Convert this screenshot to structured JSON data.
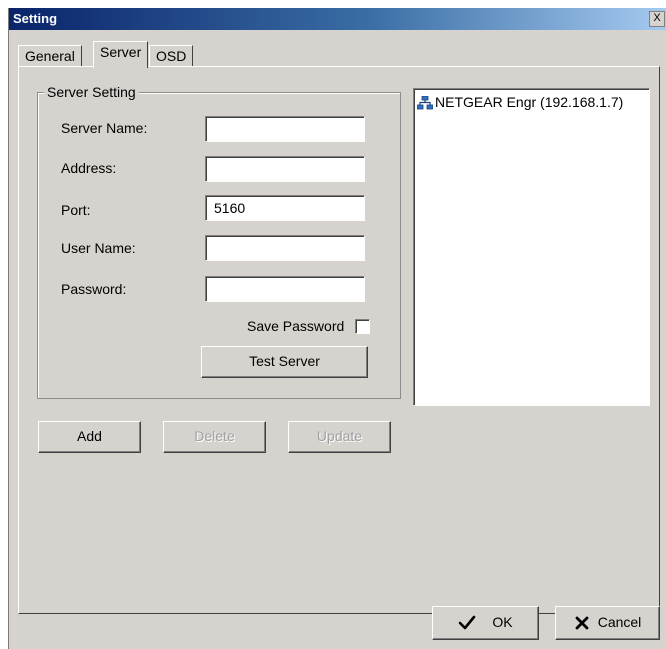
{
  "window": {
    "title": "Setting",
    "close_label": "X"
  },
  "tabs": [
    {
      "label": "General"
    },
    {
      "label": "Server"
    },
    {
      "label": "OSD"
    }
  ],
  "server_setting": {
    "group_title": "Server Setting",
    "server_name": {
      "label": "Server Name:",
      "value": ""
    },
    "address": {
      "label": "Address:",
      "value": ""
    },
    "port": {
      "label": "Port:",
      "value": "5160"
    },
    "user_name": {
      "label": "User Name:",
      "value": ""
    },
    "password": {
      "label": "Password:",
      "value": ""
    },
    "save_password": {
      "label": "Save Password",
      "checked": false
    },
    "test_server_label": "Test Server"
  },
  "server_list": {
    "items": [
      {
        "label": "NETGEAR Engr (192.168.1.7)",
        "icon": "network-icon"
      }
    ]
  },
  "actions": {
    "add_label": "Add",
    "delete_label": "Delete",
    "update_label": "Update"
  },
  "footer": {
    "ok_label": "OK",
    "cancel_label": "Cancel"
  }
}
